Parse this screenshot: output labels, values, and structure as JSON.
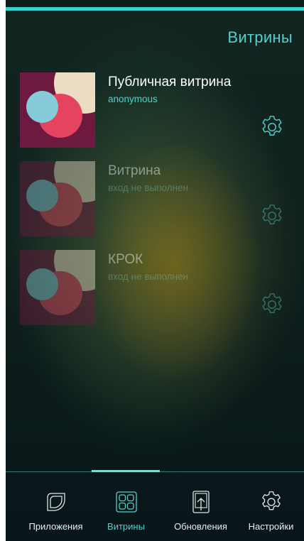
{
  "header": {
    "title": "Витрины"
  },
  "stores": [
    {
      "name": "Публичная витрина",
      "user": "anonymous",
      "dimmed": false,
      "settings_icon": "gear-icon"
    },
    {
      "name": "Витрина",
      "user": "вход не выполнен",
      "dimmed": true,
      "settings_icon": "gear-icon"
    },
    {
      "name": "КРОК",
      "user": "вход не выполнен",
      "dimmed": true,
      "settings_icon": "gear-icon"
    }
  ],
  "bottom_nav": {
    "items": [
      {
        "label": "Приложения",
        "icon": "leaf-icon",
        "active": false
      },
      {
        "label": "Витрины",
        "icon": "grid-icon",
        "active": true
      },
      {
        "label": "Обновления",
        "icon": "update-icon",
        "active": false
      },
      {
        "label": "Настройки",
        "icon": "gear-icon",
        "active": false
      }
    ]
  },
  "colors": {
    "accent": "#37d3cc",
    "text_accent": "#4fd2cb",
    "thumb_background": "#6e1a40",
    "thumb_cream": "#ecdcc4",
    "thumb_red": "#e4445f",
    "thumb_blue": "#86cbd9"
  }
}
